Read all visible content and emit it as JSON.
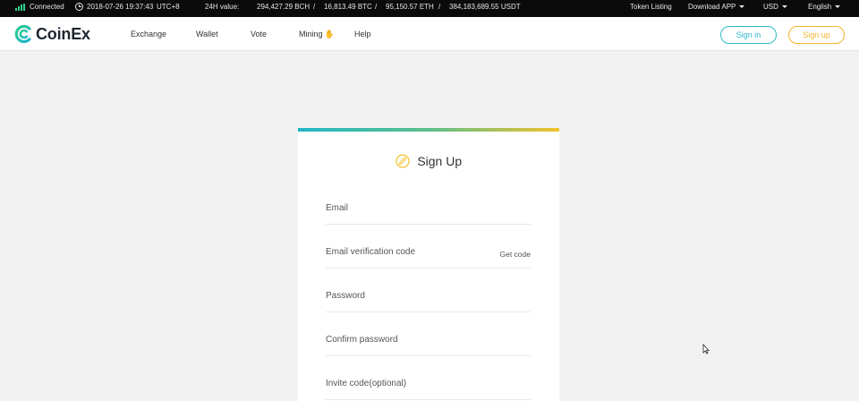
{
  "statusbar": {
    "connection": "Connected",
    "datetime": "2018-07-26 19:37:43",
    "timezone": "UTC+8",
    "value_label": "24H value:",
    "bch": "294,427.29 BCH",
    "btc": "16,813.49 BTC",
    "eth": "95,150.57 ETH",
    "usdt": "384,183,689.55 USDT",
    "separator": "/",
    "token_listing": "Token Listing",
    "download_app": "Download APP",
    "currency": "USD",
    "language": "English",
    "accent_color": "#2ecf8f"
  },
  "header": {
    "logo_text": "CoinEx",
    "nav": {
      "exchange": "Exchange",
      "wallet": "Wallet",
      "vote": "Vote",
      "mining": "Mining",
      "help": "Help"
    },
    "signin_label": "Sign in",
    "signup_label": "Sign up",
    "signin_color": "#2fb9cb",
    "signup_color": "#f0b429"
  },
  "signup_form": {
    "title": "Sign Up",
    "email_label": "Email",
    "verification_label": "Email verification code",
    "get_code_label": "Get code",
    "password_label": "Password",
    "confirm_password_label": "Confirm password",
    "invite_code_label": "Invite code(optional)"
  }
}
